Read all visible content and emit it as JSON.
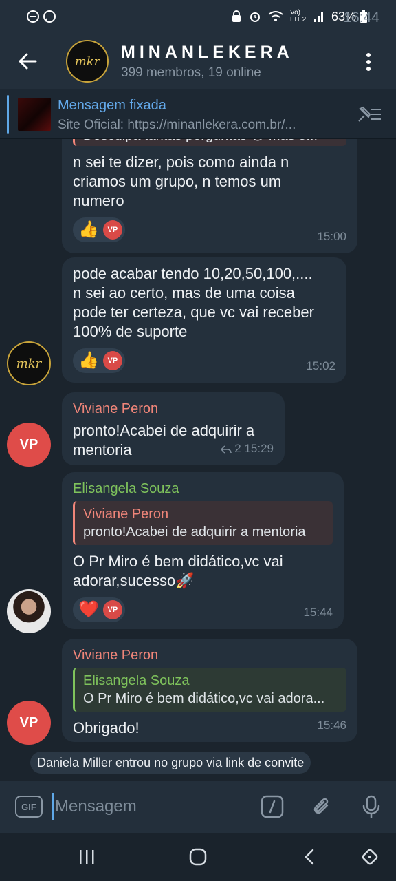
{
  "status_bar": {
    "time": "16:44",
    "battery": "63%",
    "network": "Vo) LTE2"
  },
  "header": {
    "avatar_text": "mkr",
    "title": "MINANLEKERA",
    "subtitle": "399 membros, 19 online"
  },
  "pinned": {
    "title": "Mensagem fixada",
    "body": "Site Oficial:   https://minanlekera.com.br/..."
  },
  "messages": [
    {
      "partial_top": "Desculpa tantas perguntas 😅 mas o...",
      "text": "n sei te dizer, pois como ainda n\ncriamos um grupo, n temos um\nnumero",
      "reaction": "👍",
      "reactor": "VP",
      "time": "15:00"
    },
    {
      "text": "pode acabar tendo 10,20,50,100,....\nn sei ao certo, mas de uma coisa\npode ter certeza, que vc vai receber\n100% de suporte",
      "reaction": "👍",
      "reactor": "VP",
      "time": "15:02",
      "avatar": "mkr"
    },
    {
      "sender": "Viviane Peron",
      "text": "pronto!Acabei de adquirir a\nmentoria",
      "replies": "2",
      "time": "15:29",
      "avatar": "VP"
    },
    {
      "sender": "Elisangela Souza",
      "quote_name": "Viviane Peron",
      "quote_text": "pronto!Acabei de adquirir a mentoria",
      "text": "O Pr Miro é bem didático,vc vai\nadorar,sucesso🚀",
      "reaction": "❤️",
      "reactor": "VP",
      "time": "15:44"
    },
    {
      "sender": "Viviane Peron",
      "quote_name": "Elisangela Souza",
      "quote_text": "O Pr Miro é bem didático,vc vai adora...",
      "text": "Obrigado!",
      "time": "15:46",
      "avatar": "VP"
    }
  ],
  "service_message": "Daniela Miller entrou no grupo via link de convite",
  "input": {
    "gif_label": "GIF",
    "placeholder": "Mensagem"
  },
  "colors": {
    "accent": "#5fa8e8",
    "pink_name": "#ef8579",
    "green_name": "#7fc35c",
    "bubble": "#24303c",
    "background": "#1b242d"
  }
}
